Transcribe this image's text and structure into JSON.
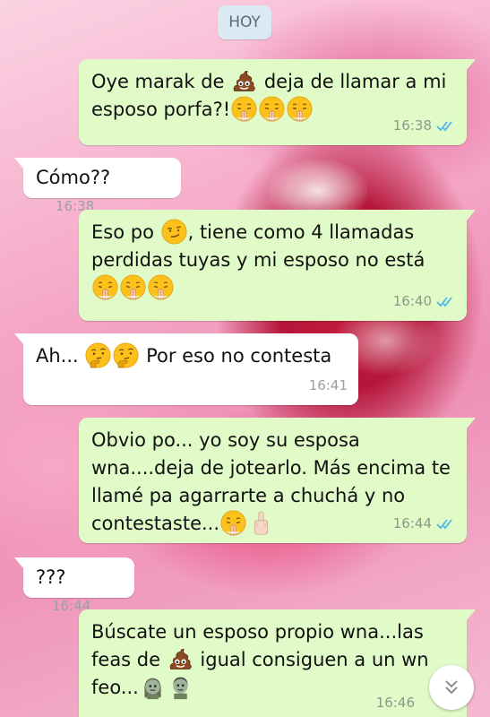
{
  "date_chip": "HOY",
  "messages": [
    {
      "dir": "out",
      "parts": [
        "Oye marak de ",
        "poop",
        " deja de llamar a mi esposo porfa?!",
        "pray",
        "pray",
        "pray"
      ],
      "time": "16:38",
      "read": true
    },
    {
      "dir": "in",
      "text": "Cómo??",
      "time": "16:38"
    },
    {
      "dir": "out",
      "parts": [
        "Eso po ",
        "smirk",
        ", tiene como 4 llamadas perdidas tuyas y mi esposo no está ",
        "pray",
        "pray",
        "pray"
      ],
      "time": "16:40",
      "read": true
    },
    {
      "dir": "in",
      "parts": [
        "Ah... ",
        "thinking",
        "thinking",
        " Por eso no contesta"
      ],
      "time": "16:41"
    },
    {
      "dir": "out",
      "parts": [
        "Obvio po... yo soy su esposa wna....deja de jotearlo. Más encima te llamé pa agarrarte a chuchá y no contestaste...",
        "pray",
        "middle-finger"
      ],
      "time": "16:44",
      "read": true
    },
    {
      "dir": "in",
      "text": "???",
      "time": "16:44"
    },
    {
      "dir": "out",
      "parts": [
        "Búscate un esposo propio wna...las feas de ",
        "poop",
        " igual consiguen a un wn feo...",
        "zombie-woman",
        "zombie-man"
      ],
      "time": "16:46",
      "read": true
    }
  ],
  "icons": {
    "read_ticks": "double-check-icon",
    "scroll_down": "double-chevron-down-icon"
  },
  "colors": {
    "outgoing_bubble": "#e1fbc8",
    "incoming_bubble": "#ffffff",
    "read_ticks": "#4fb6ec",
    "date_chip": "#dbe9f2"
  }
}
